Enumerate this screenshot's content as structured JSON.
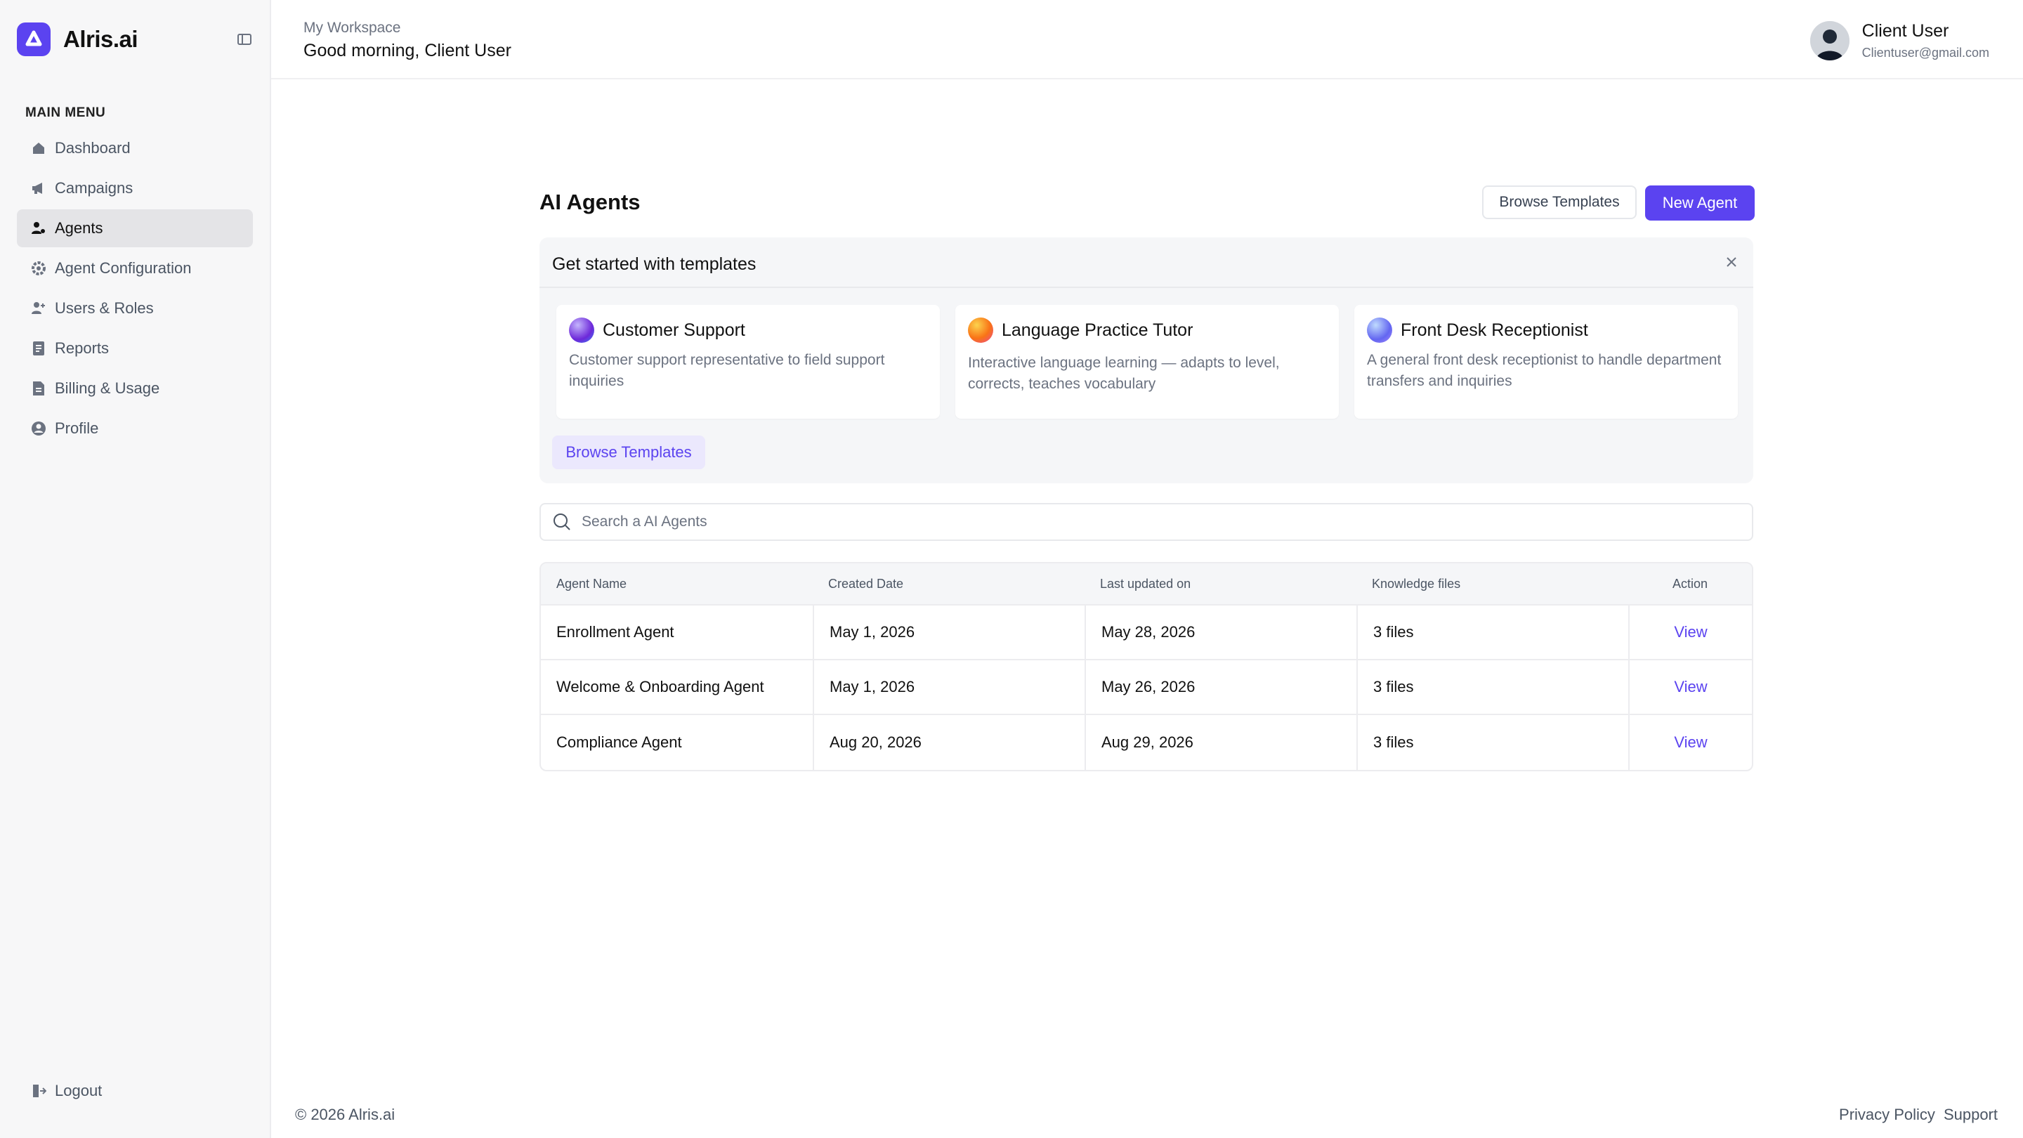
{
  "brand": {
    "name": "Alris.ai",
    "accent": "#5b43f0"
  },
  "sidebar": {
    "heading": "MAIN MENU",
    "items": [
      {
        "label": "Dashboard",
        "icon": "home-icon"
      },
      {
        "label": "Campaigns",
        "icon": "megaphone-icon"
      },
      {
        "label": "Agents",
        "icon": "agents-icon",
        "active": true
      },
      {
        "label": "Agent Configuration",
        "icon": "gear-icon"
      },
      {
        "label": "Users & Roles",
        "icon": "user-plus-icon"
      },
      {
        "label": "Reports",
        "icon": "report-icon"
      },
      {
        "label": "Billing & Usage",
        "icon": "billing-icon"
      },
      {
        "label": "Profile",
        "icon": "profile-icon"
      }
    ],
    "logout": "Logout"
  },
  "header": {
    "workspace": "My Workspace",
    "greeting": "Good morning, Client User",
    "user_name": "Client User",
    "user_email": "Clientuser@gmail.com"
  },
  "main": {
    "title": "AI Agents",
    "browse_templates": "Browse Templates",
    "new_agent": "New Agent",
    "templates": {
      "title": "Get started with templates",
      "cards": [
        {
          "title": "Customer Support",
          "description": "Customer support representative to field support inquiries"
        },
        {
          "title": "Language Practice Tutor",
          "description": "Interactive language learning — adapts to level, corrects, teaches vocabulary"
        },
        {
          "title": "Front Desk Receptionist",
          "description": "A general front desk receptionist to handle department transfers and inquiries"
        }
      ],
      "browse_button": "Browse Templates"
    },
    "search": {
      "placeholder": "Search a AI Agents",
      "value": ""
    },
    "table": {
      "columns": [
        "Agent Name",
        "Created Date",
        "Last updated on",
        "Knowledge files",
        "Action"
      ],
      "rows": [
        {
          "name": "Enrollment Agent",
          "created": "May 1, 2026",
          "updated": "May 28, 2026",
          "files": "3 files",
          "action": "View"
        },
        {
          "name": "Welcome & Onboarding Agent",
          "created": "May 1, 2026",
          "updated": "May 26, 2026",
          "files": "3 files",
          "action": "View"
        },
        {
          "name": "Compliance Agent",
          "created": "Aug 20, 2026",
          "updated": "Aug 29, 2026",
          "files": "3 files",
          "action": "View"
        }
      ]
    }
  },
  "footer": {
    "copyright": "© 2026 Alris.ai",
    "privacy": "Privacy Policy",
    "support": "Support"
  }
}
